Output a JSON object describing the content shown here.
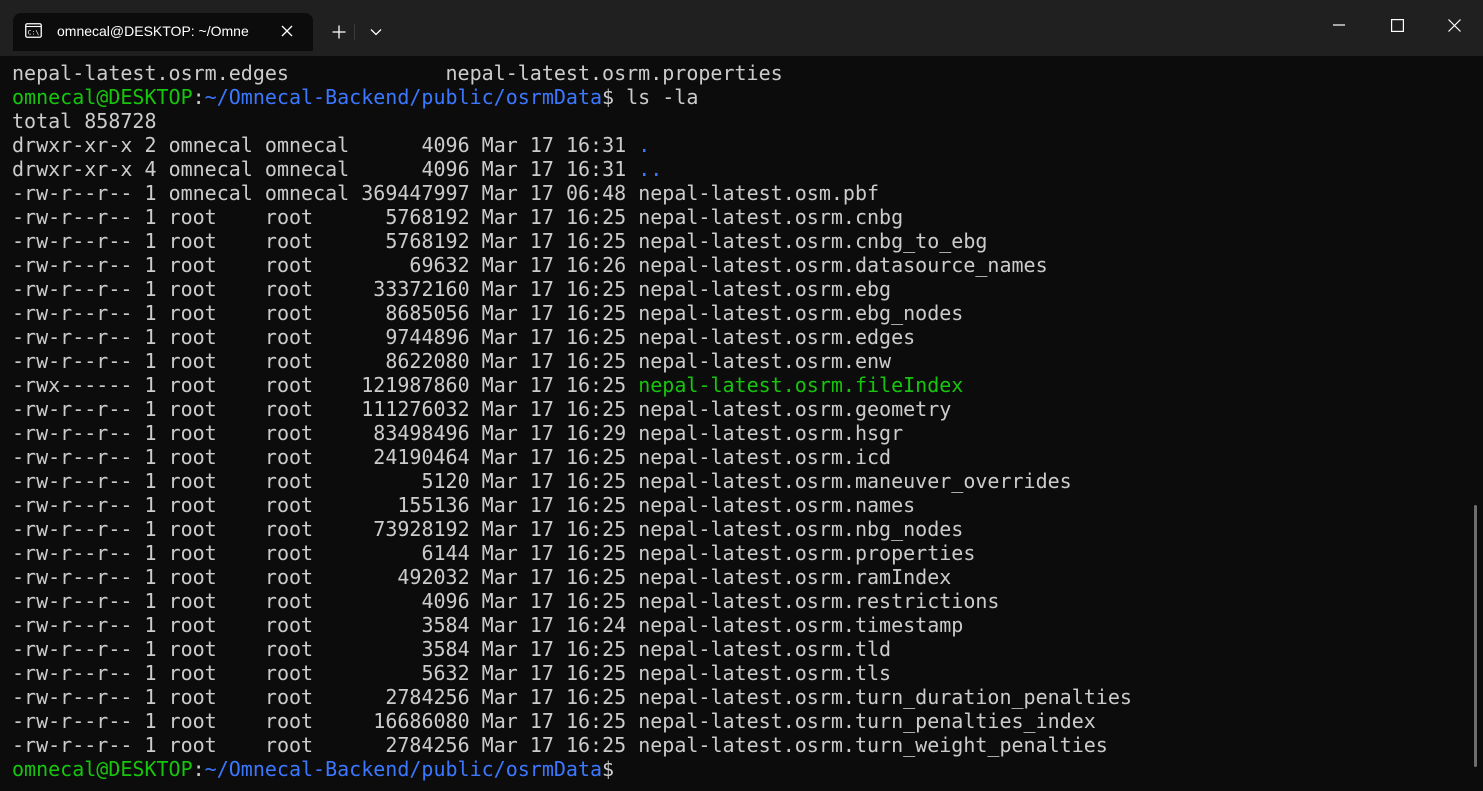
{
  "window": {
    "tab_title": "omnecal@DESKTOP: ~/Omne",
    "icons": {
      "tab": "terminal-icon",
      "tab_close": "close-icon",
      "new_tab": "plus-icon",
      "dropdown": "chevron-down-icon",
      "minimize": "minimize-icon",
      "maximize": "maximize-icon",
      "close": "close-icon"
    }
  },
  "colors": {
    "background": "#0c0c0c",
    "titlebar": "#202020",
    "text": "#cccccc",
    "prompt_user": "#16c60c",
    "prompt_path": "#3b78ff",
    "directory": "#3b78ff",
    "executable": "#16c60c"
  },
  "terminal": {
    "top_line": {
      "left": "nepal-latest.osrm.edges",
      "right": "nepal-latest.osrm.properties"
    },
    "prompt1": {
      "user": "omnecal@DESKTOP",
      "sep": ":",
      "path": "~/Omnecal-Backend/public/osrmData",
      "symbol": "$",
      "command": " ls -la"
    },
    "total": "total 858728",
    "listing": [
      {
        "perms": "drwxr-xr-x",
        "links": "2",
        "owner": "omnecal",
        "group": "omnecal",
        "size": "4096",
        "date": "Mar 17 16:31",
        "name": ".",
        "kind": "dir"
      },
      {
        "perms": "drwxr-xr-x",
        "links": "4",
        "owner": "omnecal",
        "group": "omnecal",
        "size": "4096",
        "date": "Mar 17 16:31",
        "name": "..",
        "kind": "dir"
      },
      {
        "perms": "-rw-r--r--",
        "links": "1",
        "owner": "omnecal",
        "group": "omnecal",
        "size": "369447997",
        "date": "Mar 17 06:48",
        "name": "nepal-latest.osm.pbf",
        "kind": "file"
      },
      {
        "perms": "-rw-r--r--",
        "links": "1",
        "owner": "root",
        "group": "root",
        "size": "5768192",
        "date": "Mar 17 16:25",
        "name": "nepal-latest.osrm.cnbg",
        "kind": "file"
      },
      {
        "perms": "-rw-r--r--",
        "links": "1",
        "owner": "root",
        "group": "root",
        "size": "5768192",
        "date": "Mar 17 16:25",
        "name": "nepal-latest.osrm.cnbg_to_ebg",
        "kind": "file"
      },
      {
        "perms": "-rw-r--r--",
        "links": "1",
        "owner": "root",
        "group": "root",
        "size": "69632",
        "date": "Mar 17 16:26",
        "name": "nepal-latest.osrm.datasource_names",
        "kind": "file"
      },
      {
        "perms": "-rw-r--r--",
        "links": "1",
        "owner": "root",
        "group": "root",
        "size": "33372160",
        "date": "Mar 17 16:25",
        "name": "nepal-latest.osrm.ebg",
        "kind": "file"
      },
      {
        "perms": "-rw-r--r--",
        "links": "1",
        "owner": "root",
        "group": "root",
        "size": "8685056",
        "date": "Mar 17 16:25",
        "name": "nepal-latest.osrm.ebg_nodes",
        "kind": "file"
      },
      {
        "perms": "-rw-r--r--",
        "links": "1",
        "owner": "root",
        "group": "root",
        "size": "9744896",
        "date": "Mar 17 16:25",
        "name": "nepal-latest.osrm.edges",
        "kind": "file"
      },
      {
        "perms": "-rw-r--r--",
        "links": "1",
        "owner": "root",
        "group": "root",
        "size": "8622080",
        "date": "Mar 17 16:25",
        "name": "nepal-latest.osrm.enw",
        "kind": "file"
      },
      {
        "perms": "-rwx------",
        "links": "1",
        "owner": "root",
        "group": "root",
        "size": "121987860",
        "date": "Mar 17 16:25",
        "name": "nepal-latest.osrm.fileIndex",
        "kind": "exec"
      },
      {
        "perms": "-rw-r--r--",
        "links": "1",
        "owner": "root",
        "group": "root",
        "size": "111276032",
        "date": "Mar 17 16:25",
        "name": "nepal-latest.osrm.geometry",
        "kind": "file"
      },
      {
        "perms": "-rw-r--r--",
        "links": "1",
        "owner": "root",
        "group": "root",
        "size": "83498496",
        "date": "Mar 17 16:29",
        "name": "nepal-latest.osrm.hsgr",
        "kind": "file"
      },
      {
        "perms": "-rw-r--r--",
        "links": "1",
        "owner": "root",
        "group": "root",
        "size": "24190464",
        "date": "Mar 17 16:25",
        "name": "nepal-latest.osrm.icd",
        "kind": "file"
      },
      {
        "perms": "-rw-r--r--",
        "links": "1",
        "owner": "root",
        "group": "root",
        "size": "5120",
        "date": "Mar 17 16:25",
        "name": "nepal-latest.osrm.maneuver_overrides",
        "kind": "file"
      },
      {
        "perms": "-rw-r--r--",
        "links": "1",
        "owner": "root",
        "group": "root",
        "size": "155136",
        "date": "Mar 17 16:25",
        "name": "nepal-latest.osrm.names",
        "kind": "file"
      },
      {
        "perms": "-rw-r--r--",
        "links": "1",
        "owner": "root",
        "group": "root",
        "size": "73928192",
        "date": "Mar 17 16:25",
        "name": "nepal-latest.osrm.nbg_nodes",
        "kind": "file"
      },
      {
        "perms": "-rw-r--r--",
        "links": "1",
        "owner": "root",
        "group": "root",
        "size": "6144",
        "date": "Mar 17 16:25",
        "name": "nepal-latest.osrm.properties",
        "kind": "file"
      },
      {
        "perms": "-rw-r--r--",
        "links": "1",
        "owner": "root",
        "group": "root",
        "size": "492032",
        "date": "Mar 17 16:25",
        "name": "nepal-latest.osrm.ramIndex",
        "kind": "file"
      },
      {
        "perms": "-rw-r--r--",
        "links": "1",
        "owner": "root",
        "group": "root",
        "size": "4096",
        "date": "Mar 17 16:25",
        "name": "nepal-latest.osrm.restrictions",
        "kind": "file"
      },
      {
        "perms": "-rw-r--r--",
        "links": "1",
        "owner": "root",
        "group": "root",
        "size": "3584",
        "date": "Mar 17 16:24",
        "name": "nepal-latest.osrm.timestamp",
        "kind": "file"
      },
      {
        "perms": "-rw-r--r--",
        "links": "1",
        "owner": "root",
        "group": "root",
        "size": "3584",
        "date": "Mar 17 16:25",
        "name": "nepal-latest.osrm.tld",
        "kind": "file"
      },
      {
        "perms": "-rw-r--r--",
        "links": "1",
        "owner": "root",
        "group": "root",
        "size": "5632",
        "date": "Mar 17 16:25",
        "name": "nepal-latest.osrm.tls",
        "kind": "file"
      },
      {
        "perms": "-rw-r--r--",
        "links": "1",
        "owner": "root",
        "group": "root",
        "size": "2784256",
        "date": "Mar 17 16:25",
        "name": "nepal-latest.osrm.turn_duration_penalties",
        "kind": "file"
      },
      {
        "perms": "-rw-r--r--",
        "links": "1",
        "owner": "root",
        "group": "root",
        "size": "16686080",
        "date": "Mar 17 16:25",
        "name": "nepal-latest.osrm.turn_penalties_index",
        "kind": "file"
      },
      {
        "perms": "-rw-r--r--",
        "links": "1",
        "owner": "root",
        "group": "root",
        "size": "2784256",
        "date": "Mar 17 16:25",
        "name": "nepal-latest.osrm.turn_weight_penalties",
        "kind": "file"
      }
    ],
    "prompt2": {
      "user": "omnecal@DESKTOP",
      "sep": ":",
      "path": "~/Omnecal-Backend/public/osrmData",
      "symbol": "$"
    }
  }
}
